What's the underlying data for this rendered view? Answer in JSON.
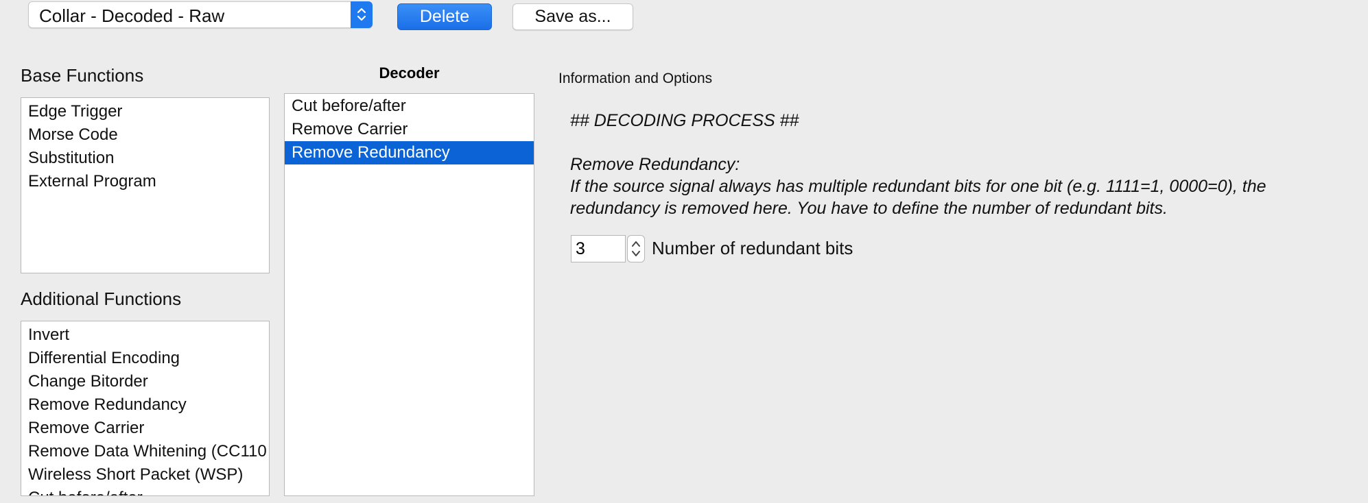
{
  "toolbar": {
    "preset_select": {
      "value": "Collar - Decoded - Raw",
      "icon": "chevron-up-down-icon"
    },
    "delete_label": "Delete",
    "save_as_label": "Save as..."
  },
  "base_functions": {
    "heading": "Base Functions",
    "items": [
      "Edge Trigger",
      "Morse Code",
      "Substitution",
      "External Program"
    ]
  },
  "additional_functions": {
    "heading": "Additional Functions",
    "items": [
      "Invert",
      "Differential Encoding",
      "Change Bitorder",
      "Remove Redundancy",
      "Remove Carrier",
      "Remove Data Whitening (CC110",
      "Wireless Short Packet (WSP)",
      "Cut before/after"
    ]
  },
  "decoder": {
    "heading": "Decoder",
    "items": [
      "Cut before/after",
      "Remove Carrier",
      "Remove Redundancy"
    ],
    "selected_index": 2
  },
  "info": {
    "heading": "Information and Options",
    "title": "## DECODING PROCESS ##",
    "subtitle": "Remove Redundancy:",
    "line1": "If the source signal always has multiple redundant bits for one bit (e.g. 1111=1, 0000=0), the",
    "line2": "redundancy is removed here. You have to define the number of redundant bits.",
    "redundant_bits": {
      "value": "3",
      "label": "Number of redundant bits"
    }
  },
  "colors": {
    "accent": "#1f7af0",
    "selection": "#0b63d6",
    "background": "#ececec"
  }
}
